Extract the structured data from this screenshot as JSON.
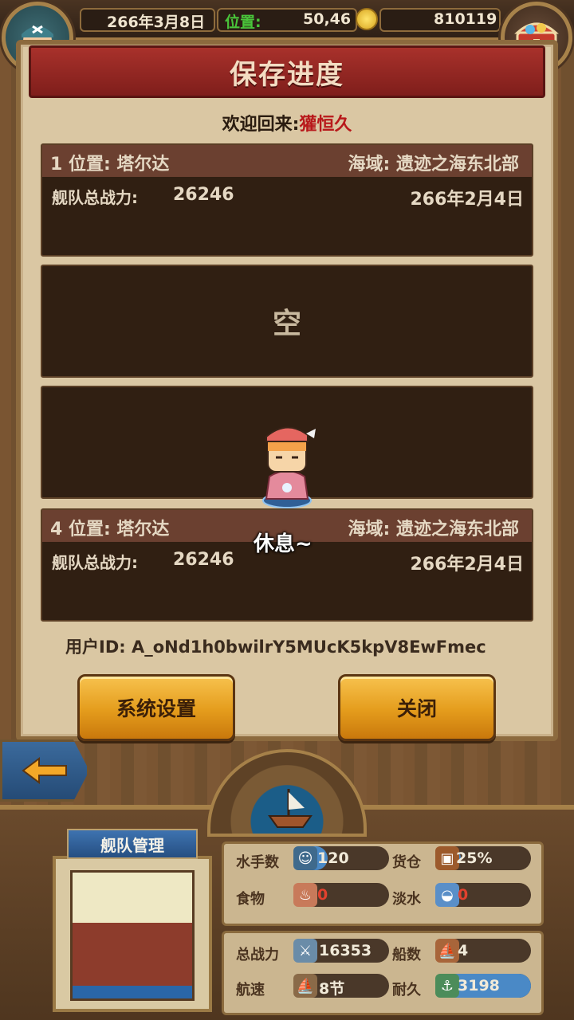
{
  "topbar": {
    "date": "266年3月8日",
    "position_label": "位置:",
    "position_value": "50,46",
    "gold": "810119"
  },
  "dialog": {
    "title": "保存进度",
    "welcome_prefix": "欢迎回来:",
    "player_name": "獾恒久"
  },
  "slots": [
    {
      "index_position": "1 位置: 塔尔达",
      "sea_area": "海域: 遗迹之海东北部",
      "fleet_power_label": "舰队总战力:",
      "fleet_power": "26246",
      "date": "266年2月4日"
    },
    {
      "empty_label": "空"
    },
    {},
    {
      "index_position": "4 位置: 塔尔达",
      "sea_area": "海域: 遗迹之海东北部",
      "fleet_power_label": "舰队总战力:",
      "fleet_power": "26246",
      "date": "266年2月4日"
    }
  ],
  "character": {
    "status_text": "休息~"
  },
  "user_id": "用户ID: A_oNd1h0bwilrY5MUcK5kpV8EwFmec",
  "buttons": {
    "settings": "系统设置",
    "close": "关闭"
  },
  "dashboard": {
    "fleet_management": "舰队管理",
    "stats": {
      "sailors_label": "水手数",
      "sailors_value": "120",
      "sailors_fill": 0.35,
      "cargo_label": "货仓",
      "cargo_value": "25%",
      "cargo_fill": 0.25,
      "food_label": "食物",
      "food_value": "0",
      "water_label": "淡水",
      "water_value": "0",
      "power_label": "总战力",
      "power_value": "16353",
      "ships_label": "船数",
      "ships_value": "4",
      "speed_label": "航速",
      "speed_value": "8节",
      "durability_label": "耐久",
      "durability_value": "3198",
      "durability_fill": 1.0
    }
  },
  "colors": {
    "title_red": "#a8312b",
    "button_gold": "#e49c1c",
    "bar_blue": "#4a89c6",
    "slot_dark": "#301f12",
    "name_red": "#b8191b"
  }
}
